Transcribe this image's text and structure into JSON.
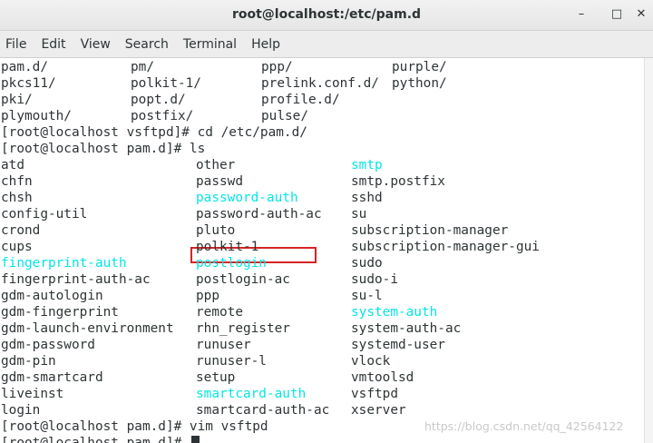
{
  "window": {
    "title": "root@localhost:/etc/pam.d",
    "minimize_glyph": "–",
    "maximize_glyph": "□",
    "close_glyph": "✕"
  },
  "menu": [
    "File",
    "Edit",
    "View",
    "Search",
    "Terminal",
    "Help"
  ],
  "terminal": {
    "top_rows": [
      [
        "pam.d/",
        "pm/",
        "ppp/",
        "purple/"
      ],
      [
        "pkcs11/",
        "polkit-1/",
        "prelink.conf.d/",
        "python/"
      ],
      [
        "pki/",
        "popt.d/",
        "profile.d/",
        ""
      ],
      [
        "plymouth/",
        "postfix/",
        "pulse/",
        ""
      ]
    ],
    "cmd1": "[root@localhost vsftpd]# cd /etc/pam.d/",
    "cmd2": "[root@localhost pam.d]# ls",
    "ls_rows": [
      [
        {
          "t": "atd"
        },
        {
          "t": "other"
        },
        {
          "t": "smtp",
          "c": true
        }
      ],
      [
        {
          "t": "chfn"
        },
        {
          "t": "passwd"
        },
        {
          "t": "smtp.postfix"
        }
      ],
      [
        {
          "t": "chsh"
        },
        {
          "t": "password-auth",
          "c": true
        },
        {
          "t": "sshd"
        }
      ],
      [
        {
          "t": "config-util"
        },
        {
          "t": "password-auth-ac"
        },
        {
          "t": "su"
        }
      ],
      [
        {
          "t": "crond"
        },
        {
          "t": "pluto"
        },
        {
          "t": "subscription-manager"
        }
      ],
      [
        {
          "t": "cups"
        },
        {
          "t": "polkit-1"
        },
        {
          "t": "subscription-manager-gui"
        }
      ],
      [
        {
          "t": "fingerprint-auth",
          "c": true
        },
        {
          "t": "postlogin",
          "c": true
        },
        {
          "t": "sudo"
        }
      ],
      [
        {
          "t": "fingerprint-auth-ac"
        },
        {
          "t": "postlogin-ac"
        },
        {
          "t": "sudo-i"
        }
      ],
      [
        {
          "t": "gdm-autologin"
        },
        {
          "t": "ppp"
        },
        {
          "t": "su-l"
        }
      ],
      [
        {
          "t": "gdm-fingerprint"
        },
        {
          "t": "remote"
        },
        {
          "t": "system-auth",
          "c": true
        }
      ],
      [
        {
          "t": "gdm-launch-environment"
        },
        {
          "t": "rhn_register"
        },
        {
          "t": "system-auth-ac"
        }
      ],
      [
        {
          "t": "gdm-password"
        },
        {
          "t": "runuser"
        },
        {
          "t": "systemd-user"
        }
      ],
      [
        {
          "t": "gdm-pin"
        },
        {
          "t": "runuser-l"
        },
        {
          "t": "vlock"
        }
      ],
      [
        {
          "t": "gdm-smartcard"
        },
        {
          "t": "setup"
        },
        {
          "t": "vmtoolsd"
        }
      ],
      [
        {
          "t": "liveinst"
        },
        {
          "t": "smartcard-auth",
          "c": true
        },
        {
          "t": "vsftpd"
        }
      ],
      [
        {
          "t": "login"
        },
        {
          "t": "smartcard-auth-ac"
        },
        {
          "t": "xserver"
        }
      ]
    ],
    "cmd3": "[root@localhost pam.d]# vim vsftpd",
    "cmd4": "[root@localhost pam.d]# ",
    "cyan_color": "#06e5e5",
    "highlight_color": "#d42424"
  },
  "watermark": "https://blog.csdn.net/qq_42564122"
}
